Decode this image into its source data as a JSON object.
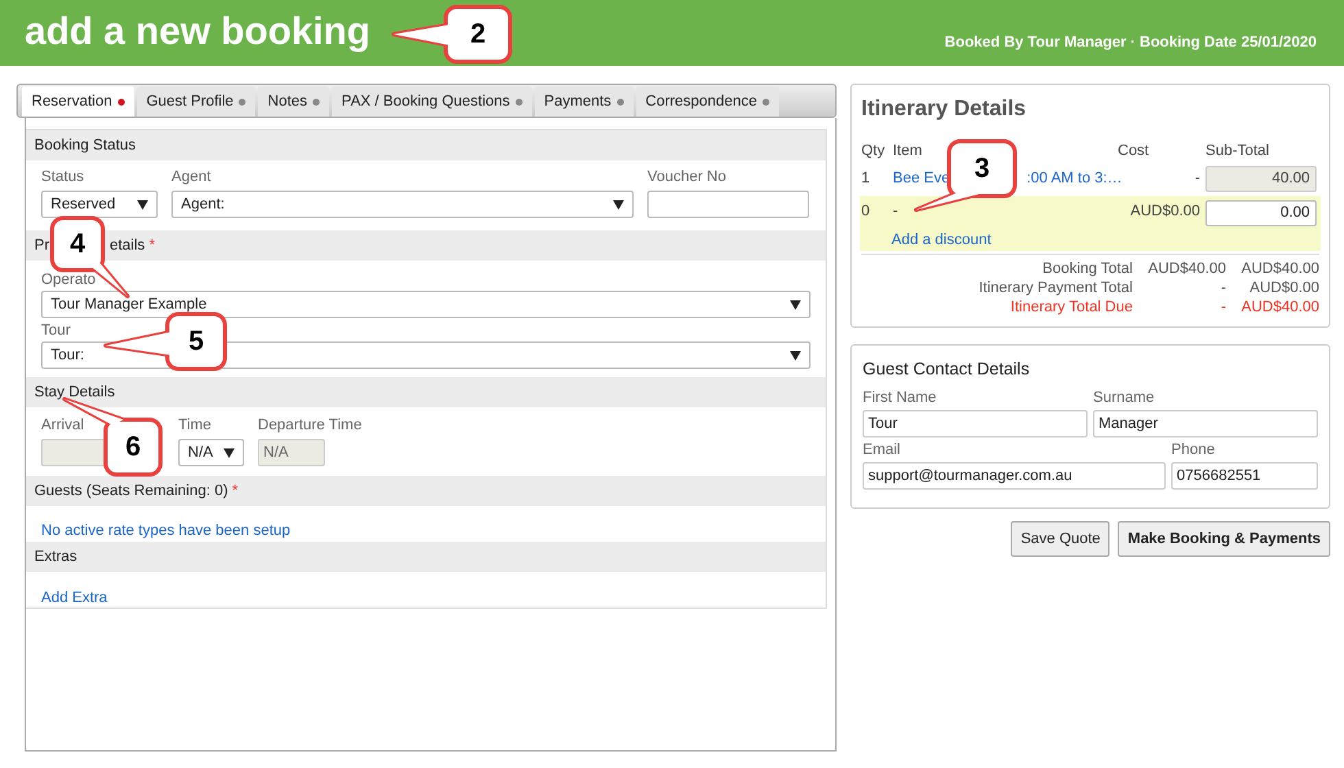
{
  "header": {
    "title": "add a new booking",
    "meta": "Booked By Tour Manager · Booking Date 25/01/2020"
  },
  "tabs": [
    {
      "label": "Reservation",
      "selected": true
    },
    {
      "label": "Guest Profile",
      "selected": false
    },
    {
      "label": "Notes",
      "selected": false
    },
    {
      "label": "PAX / Booking Questions",
      "selected": false
    },
    {
      "label": "Payments",
      "selected": false
    },
    {
      "label": "Correspondence",
      "selected": false
    }
  ],
  "booking_status": {
    "heading": "Booking Status",
    "status_label": "Status",
    "status_value": "Reserved",
    "agent_label": "Agent",
    "agent_value": "Agent:",
    "voucher_label": "Voucher No"
  },
  "product_details": {
    "heading_start": "Pr",
    "heading_end": "etails",
    "required_mark": "*",
    "operator_label": "Operato",
    "operator_value": "Tour Manager Example",
    "tour_label": "Tour",
    "tour_value": "Tour:"
  },
  "stay_details": {
    "heading": "Stay Details",
    "arrival_label": "Arrival",
    "time_label": "Time",
    "time_value": "N/A",
    "departure_label": "Departure Time",
    "departure_value": "N/A"
  },
  "guests": {
    "heading": "Guests (Seats Remaining: 0)",
    "required_mark": "*",
    "message": "No active rate types have been setup"
  },
  "extras": {
    "heading": "Extras",
    "link": "Add Extra"
  },
  "itinerary": {
    "title": "Itinerary Details",
    "columns": [
      "Qty",
      "Item",
      "Cost",
      "Sub-Total"
    ],
    "item": {
      "qty": "1",
      "name_start": "Bee Eve",
      "name_end": ":00 AM to 3:…",
      "cost": "-",
      "subtotal": "40.00"
    },
    "discount": {
      "qty": "0",
      "name": "-",
      "cost": "AUD$0.00",
      "subtotal": "0.00",
      "link": "Add a discount"
    },
    "totals": [
      {
        "label": "Booking Total",
        "value_1": "AUD$40.00",
        "value_2": "AUD$40.00",
        "alert": false
      },
      {
        "label": "Itinerary Payment Total",
        "value_1": "-",
        "value_2": "AUD$0.00",
        "alert": false
      },
      {
        "label": "Itinerary Total Due",
        "value_1": "-",
        "value_2": "AUD$40.00",
        "alert": true
      }
    ]
  },
  "contact": {
    "title": "Guest Contact Details",
    "first_name_label": "First Name",
    "first_name": "Tour",
    "surname_label": "Surname",
    "surname": "Manager",
    "email_label": "Email",
    "email": "support@tourmanager.com.au",
    "phone_label": "Phone",
    "phone": "0756682551"
  },
  "buttons": [
    "Save Quote",
    "Make Booking & Payments"
  ],
  "callouts": [
    "2",
    "3",
    "4",
    "5",
    "6"
  ]
}
